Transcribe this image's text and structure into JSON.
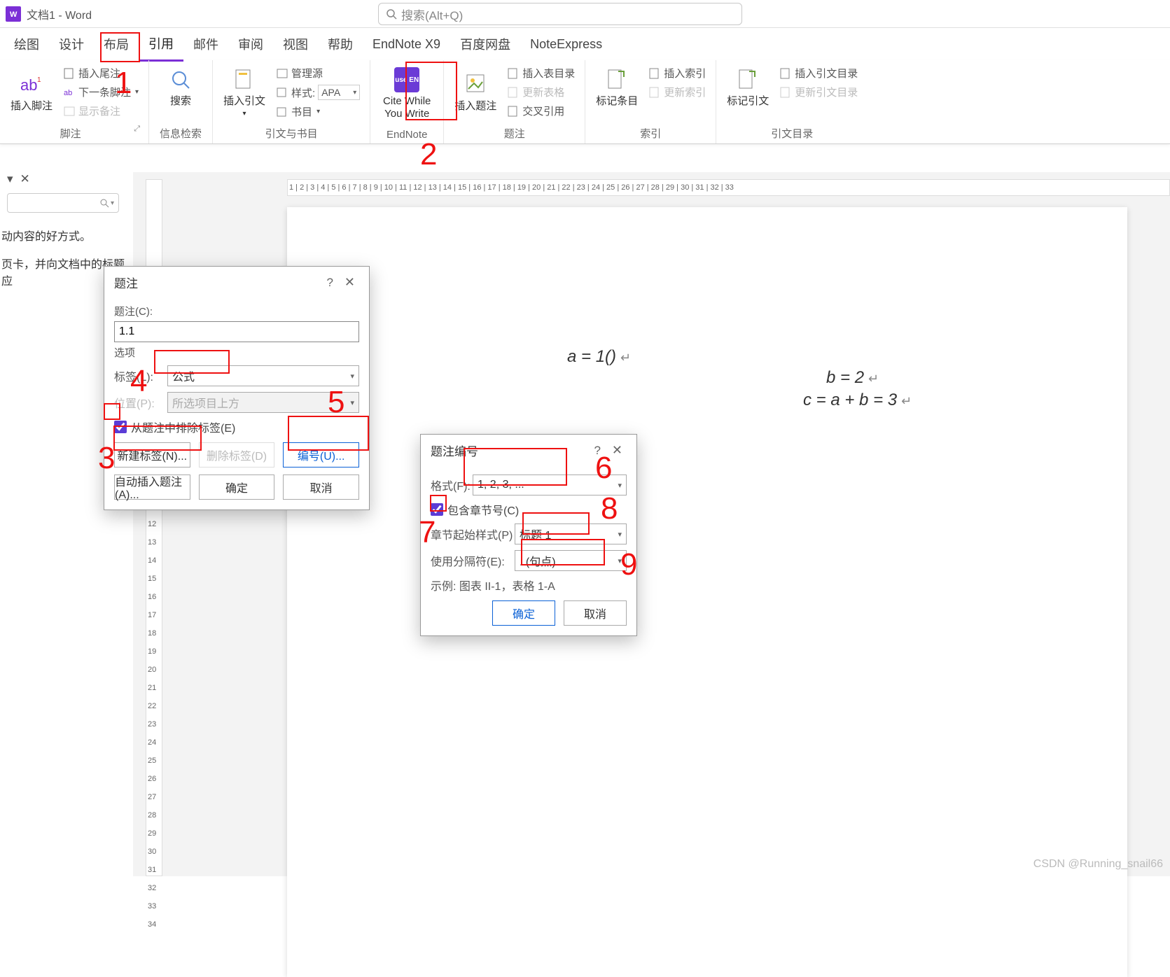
{
  "title": "文档1 - Word",
  "search_placeholder": "搜索(Alt+Q)",
  "tabs": [
    "绘图",
    "设计",
    "布局",
    "引用",
    "邮件",
    "审阅",
    "视图",
    "帮助",
    "EndNote X9",
    "百度网盘",
    "NoteExpress"
  ],
  "active_tab": "引用",
  "ribbon": {
    "footnote": {
      "big": "插入脚注",
      "insert_endnote": "插入尾注",
      "next_footnote": "下一条脚注",
      "show_notes": "显示备注",
      "group": "脚注"
    },
    "smart_lookup": {
      "big": "搜索",
      "group": "信息检索"
    },
    "citations": {
      "big": "插入引文",
      "manage_sources": "管理源",
      "style_label": "样式:",
      "style_value": "APA",
      "bibliography": "书目",
      "group": "引文与书目"
    },
    "endnote": {
      "big": "Cite While You Write",
      "badge": "use EN",
      "group": "EndNote"
    },
    "captions": {
      "big": "插入题注",
      "insert_tof": "插入表目录",
      "update_table": "更新表格",
      "cross_ref": "交叉引用",
      "group": "题注"
    },
    "index": {
      "big": "标记条目",
      "insert_index": "插入索引",
      "update_index": "更新索引",
      "group": "索引"
    },
    "toa": {
      "big": "标记引文",
      "insert_toa": "插入引文目录",
      "update_toa": "更新引文目录",
      "group": "引文目录"
    }
  },
  "nav": {
    "hint1": "动内容的好方式。",
    "hint2": "页卡，并向文档中的标题应"
  },
  "equations": {
    "eq1": "a = 1()",
    "eq2": "b = 2",
    "eq3": "c = a + b = 3"
  },
  "dialog_caption": {
    "title": "题注",
    "caption_label": "题注(C):",
    "caption_value": "1.1",
    "options": "选项",
    "label_label": "标签(L):",
    "label_value": "公式",
    "position_label": "位置(P):",
    "position_value": "所选项目上方",
    "exclude": "从题注中排除标签(E)",
    "new_label": "新建标签(N)...",
    "delete_label": "删除标签(D)",
    "numbering": "编号(U)...",
    "auto": "自动插入题注(A)...",
    "ok": "确定",
    "cancel": "取消"
  },
  "dialog_number": {
    "title": "题注编号",
    "format_label": "格式(F):",
    "format_value": "1, 2, 3, ...",
    "include": "包含章节号(C)",
    "chapter_style_label": "章节起始样式(P)",
    "chapter_style_value": "标题 1",
    "separator_label": "使用分隔符(E):",
    "separator_value": ".    (句点)",
    "example": "示例:  图表 II-1，表格 1-A",
    "ok": "确定",
    "cancel": "取消"
  },
  "annotations": {
    "n1": "1",
    "n2": "2",
    "n3": "3",
    "n4": "4",
    "n5": "5",
    "n6": "6",
    "n7": "7",
    "n8": "8",
    "n9": "9"
  },
  "watermark": "CSDN @Running_snail66",
  "ruler_numbers": "1  |  2  |  3  |  4  |  5  |  6  |  7  |  8  |  9  |  10  |  11  |  12  |  13  |  14  |  15  |  16  |  17  |  18  |  19  |  20  |  21  |  22  |  23  |  24  |  25  |  26  |  27  |  28  |  29  |  30  |  31  |  32  |  33"
}
